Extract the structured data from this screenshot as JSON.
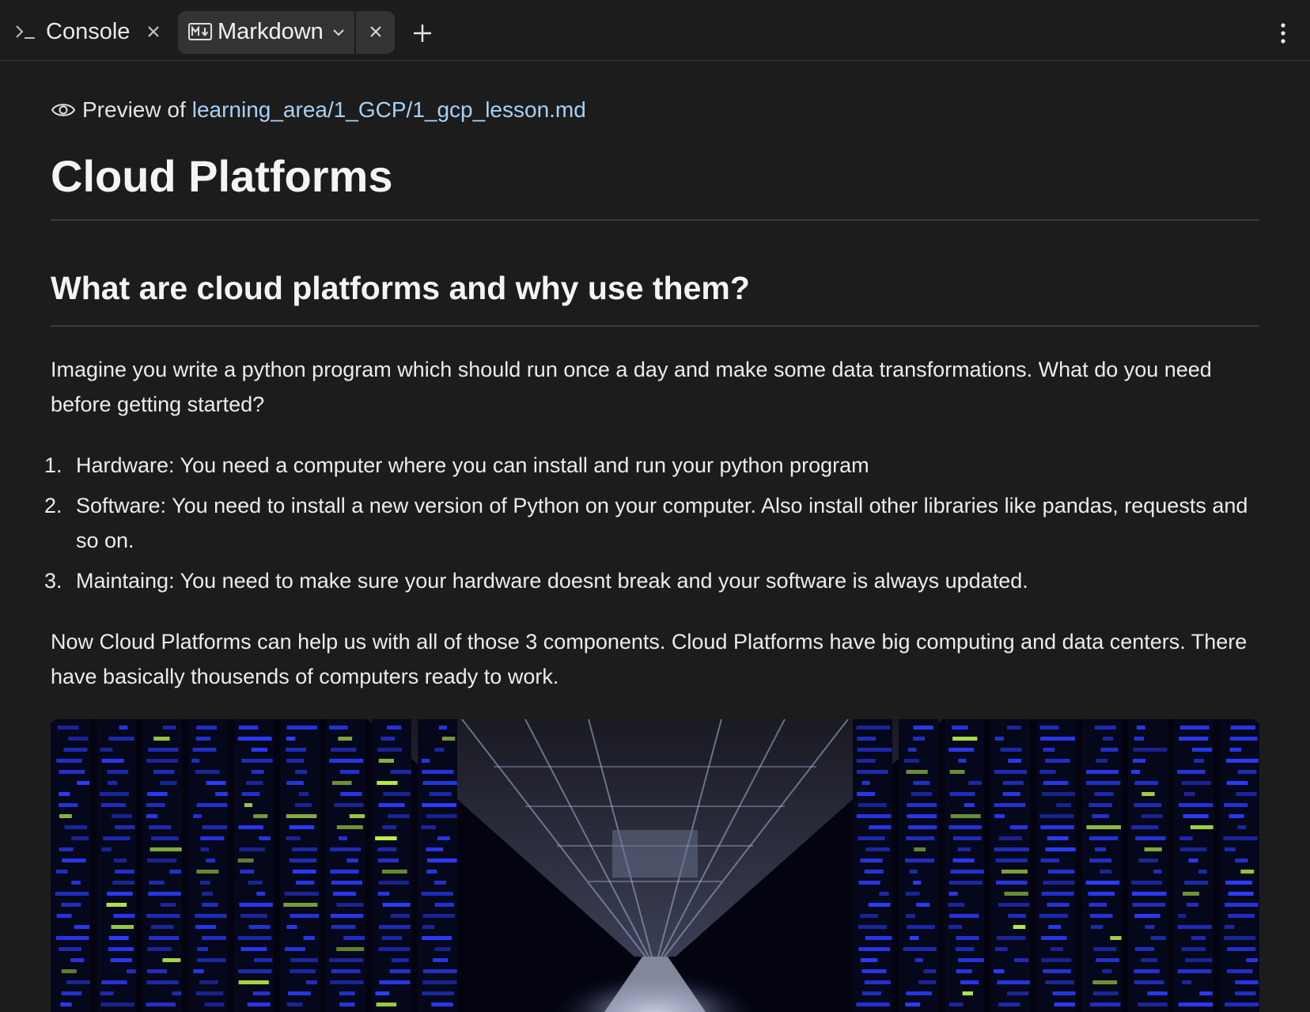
{
  "tabs": [
    {
      "label": "Console",
      "icon": "terminal-prompt-icon",
      "active": false
    },
    {
      "label": "Markdown",
      "icon": "markdown-icon",
      "active": true
    }
  ],
  "preview": {
    "prefix": "Preview of",
    "path": "learning_area/1_GCP/1_gcp_lesson.md"
  },
  "doc": {
    "h1": "Cloud Platforms",
    "h2": "What are cloud platforms and why use them?",
    "intro": "Imagine you write a python program which should run once a day and make some data transformations. What do you need before getting started?",
    "list": [
      {
        "num": "1.",
        "text": "Hardware: You need a computer where you can install and run your python program"
      },
      {
        "num": "2.",
        "text": "Software: You need to install a new version of Python on your computer. Also install other libraries like pandas, requests and so on."
      },
      {
        "num": "3.",
        "text": "Maintaing: You need to make sure your hardware doesnt break and your software is always updated."
      }
    ],
    "outro": "Now Cloud Platforms can help us with all of those 3 components. Cloud Platforms have big computing and data centers. There have basically thousends of computers ready to work.",
    "image_subject": "data center server aisle with blue lights"
  },
  "colors": {
    "background": "#1c1c1c",
    "active_tab": "#333333",
    "link": "#a8d1f7",
    "server_blue": "#2b3cff"
  }
}
